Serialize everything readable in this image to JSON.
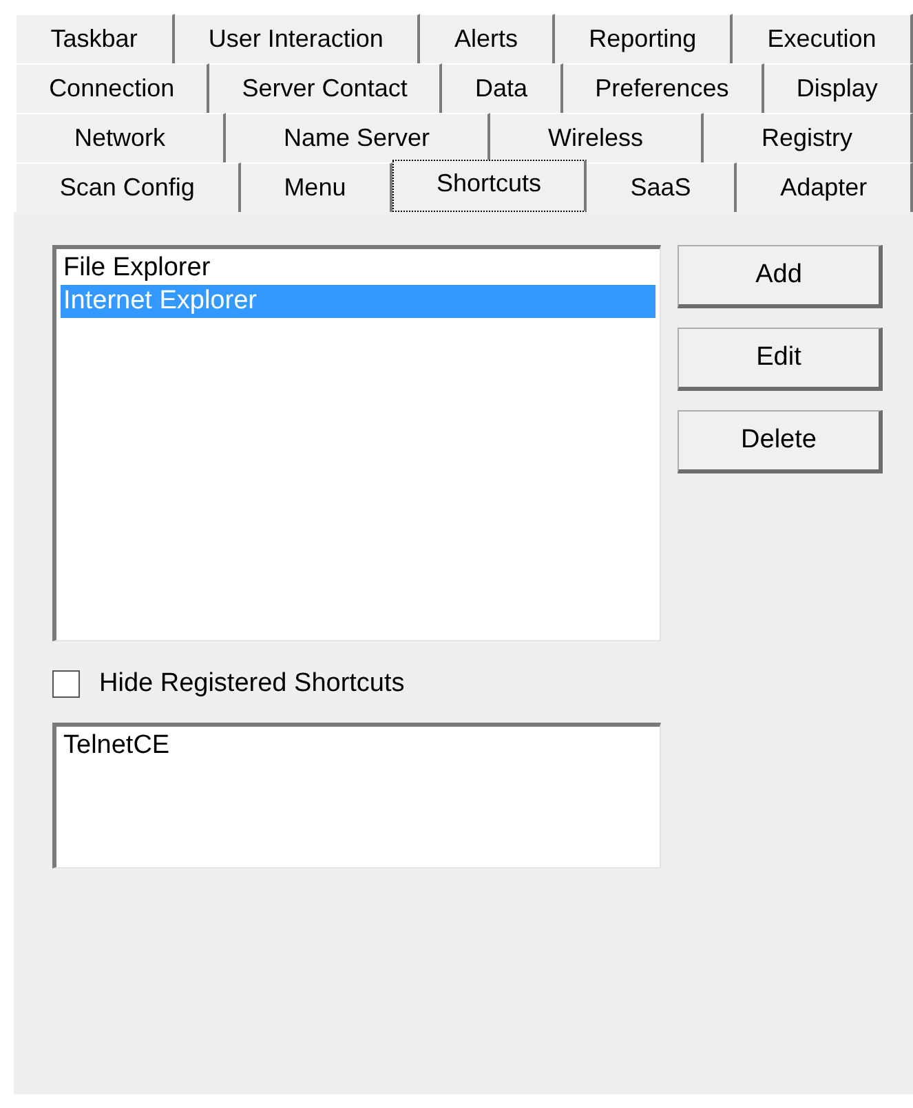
{
  "tab_rows": [
    {
      "tabs": [
        {
          "label": "Taskbar",
          "selected": false
        },
        {
          "label": "User Interaction",
          "selected": false
        },
        {
          "label": "Alerts",
          "selected": false
        },
        {
          "label": "Reporting",
          "selected": false
        },
        {
          "label": "Execution",
          "selected": false
        }
      ]
    },
    {
      "tabs": [
        {
          "label": "Connection",
          "selected": false
        },
        {
          "label": "Server Contact",
          "selected": false
        },
        {
          "label": "Data",
          "selected": false
        },
        {
          "label": "Preferences",
          "selected": false
        },
        {
          "label": "Display",
          "selected": false
        }
      ]
    },
    {
      "tabs": [
        {
          "label": "Network",
          "selected": false
        },
        {
          "label": "Name Server",
          "selected": false
        },
        {
          "label": "Wireless",
          "selected": false
        },
        {
          "label": "Registry",
          "selected": false
        }
      ]
    },
    {
      "tabs": [
        {
          "label": "Scan Config",
          "selected": false
        },
        {
          "label": "Menu",
          "selected": false
        },
        {
          "label": "Shortcuts",
          "selected": true
        },
        {
          "label": "SaaS",
          "selected": false
        },
        {
          "label": "Adapter",
          "selected": false
        }
      ]
    }
  ],
  "shortcuts_list": {
    "items": [
      {
        "label": "File Explorer",
        "selected": false
      },
      {
        "label": "Internet Explorer",
        "selected": true
      }
    ]
  },
  "buttons": [
    "Add",
    "Edit",
    "Delete"
  ],
  "hide_registered": {
    "label": "Hide Registered Shortcuts",
    "checked": false
  },
  "registered_list": {
    "items": [
      {
        "label": "TelnetCE",
        "selected": false
      }
    ]
  }
}
